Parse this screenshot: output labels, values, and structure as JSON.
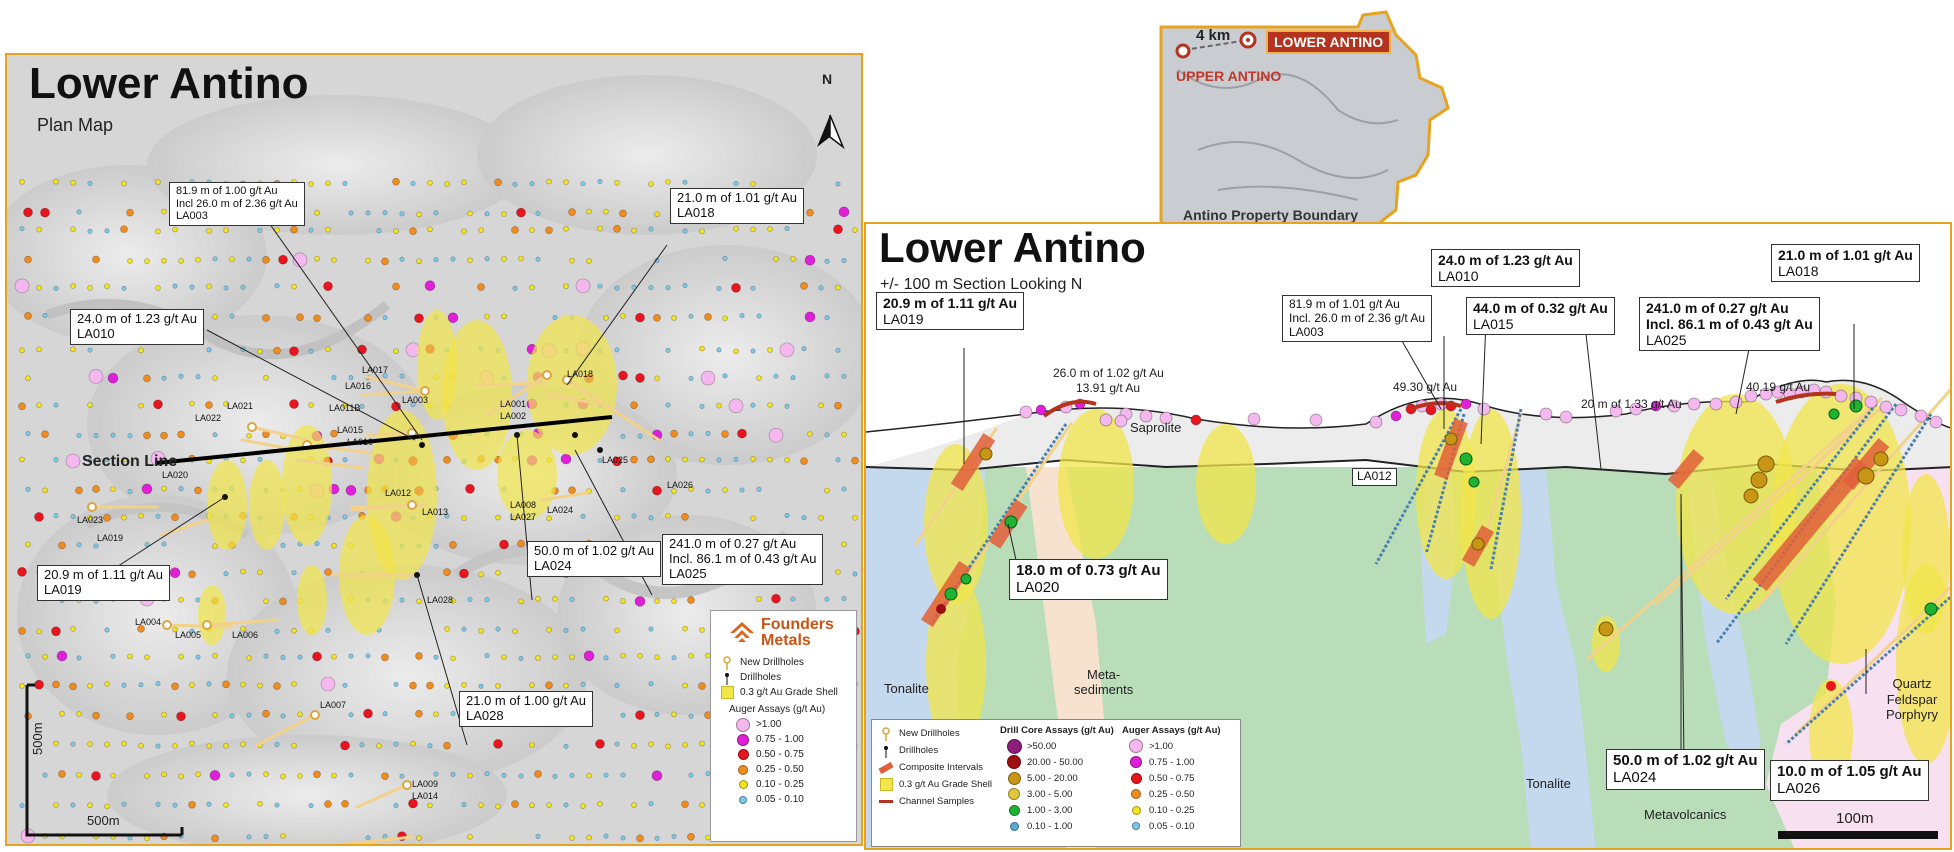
{
  "plan_map": {
    "title": "Lower Antino",
    "subtitle": "Plan Map",
    "north": "N",
    "section_line_label": "Section Line",
    "scale_h": "500m",
    "scale_v": "500m",
    "holes": [
      "LA001",
      "LA002",
      "LA003",
      "LA004",
      "LA005",
      "LA006",
      "LA007",
      "LA008",
      "LA009",
      "LA010",
      "LA011B",
      "LA012",
      "LA013",
      "LA014",
      "LA015",
      "LA016",
      "LA017",
      "LA018",
      "LA019",
      "LA020",
      "LA021",
      "LA022",
      "LA023",
      "LA024",
      "LA025",
      "LA026",
      "LA027",
      "LA028"
    ],
    "callouts": {
      "la003": [
        "81.9 m of 1.00 g/t Au",
        "Incl 26.0 m of 2.36 g/t Au",
        "LA003"
      ],
      "la018": [
        "21.0 m of 1.01 g/t Au",
        "LA018"
      ],
      "la010": [
        "24.0 m of 1.23 g/t Au",
        "LA010"
      ],
      "la019": [
        "20.9 m of 1.11 g/t Au",
        "LA019"
      ],
      "la024": [
        "50.0 m of 1.02 g/t Au",
        "LA024"
      ],
      "la025": [
        "241.0 m of 0.27 g/t Au",
        "Incl. 86.1 m of 0.43 g/t Au",
        "LA025"
      ],
      "la028": [
        "21.0 m of 1.00 g/t Au",
        "LA028"
      ]
    },
    "legend": {
      "brand_line1": "Founders",
      "brand_line2": "Metals",
      "new_drillholes": "New Drillholes",
      "drillholes": "Drillholes",
      "grade_shell": "0.3 g/t Au Grade Shell",
      "auger_title": "Auger Assays (g/t Au)",
      "auger_classes": [
        {
          "label": ">1.00",
          "color": "#f4b8ee"
        },
        {
          "label": "0.75 - 1.00",
          "color": "#e020d8"
        },
        {
          "label": "0.50 - 0.75",
          "color": "#e8141e"
        },
        {
          "label": "0.25 - 0.50",
          "color": "#f08c1e"
        },
        {
          "label": "0.10 - 0.25",
          "color": "#f4e41e"
        },
        {
          "label": "0.05 - 0.10",
          "color": "#7cc8e8"
        }
      ]
    }
  },
  "inset": {
    "distance": "4 km",
    "lower_label": "LOWER ANTINO",
    "upper_label": "UPPER ANTINO",
    "boundary_label": "Antino Property Boundary"
  },
  "section": {
    "title": "Lower Antino",
    "subtitle": "+/- 100 m Section Looking N",
    "units": {
      "saprolite": "Saprolite",
      "metasediments": [
        "Meta-",
        "sediments"
      ],
      "tonalite_left": "Tonalite",
      "tonalite_right": "Tonalite",
      "metavolcanics": "Metavolcanics",
      "qfp": [
        "Quartz",
        "Feldspar",
        "Porphyry"
      ]
    },
    "callouts": {
      "la019": [
        "20.9 m of 1.11 g/t Au",
        "LA019"
      ],
      "la020": [
        "18.0 m of 0.73 g/t Au",
        "LA020"
      ],
      "la003": [
        "81.9 m of 1.01 g/t Au",
        "Incl. 26.0 m of 2.36 g/t Au",
        "LA003"
      ],
      "la010": [
        "24.0 m of 1.23 g/t Au",
        "LA010"
      ],
      "la015": [
        "44.0 m of 0.32 g/t Au",
        "LA015"
      ],
      "la025": [
        "241.0 m of 0.27 g/t Au",
        "Incl. 86.1 m of 0.43 g/t Au",
        "LA025"
      ],
      "la018": [
        "21.0 m of 1.01 g/t Au",
        "LA018"
      ],
      "la024": [
        "50.0 m of 1.02 g/t Au",
        "LA024"
      ],
      "la026": [
        "10.0 m of 1.05 g/t Au",
        "LA026"
      ],
      "la012": "LA012"
    },
    "annotations": {
      "channel_a": "26.0 m of 1.02 g/t Au",
      "channel_b": "13.91 g/t Au",
      "point_a": "49.30 g/t Au",
      "channel_c": "20 m of 1.33 g/t Au",
      "point_b": "40.19 g/t Au"
    },
    "scale": "100m",
    "legend": {
      "new_drillholes": "New Drillholes",
      "drillholes": "Drillholes",
      "composite": "Composite Intervals",
      "grade_shell": "0.3 g/t Au Grade Shell",
      "channel": "Channel Samples",
      "core_title": "Drill Core Assays (g/t Au)",
      "core_classes": [
        {
          "label": ">50.00",
          "color": "#8a1e7a"
        },
        {
          "label": "20.00 - 50.00",
          "color": "#9e0f14"
        },
        {
          "label": "5.00 - 20.00",
          "color": "#c89614"
        },
        {
          "label": "3.00 - 5.00",
          "color": "#e0c83c"
        },
        {
          "label": "1.00 - 3.00",
          "color": "#1eb432"
        },
        {
          "label": "0.10 - 1.00",
          "color": "#5aaad2"
        }
      ],
      "auger_title": "Auger Assays (g/t Au)",
      "auger_classes": [
        {
          "label": ">1.00",
          "color": "#f4b8ee"
        },
        {
          "label": "0.75 - 1.00",
          "color": "#e020d8"
        },
        {
          "label": "0.50 - 0.75",
          "color": "#e8141e"
        },
        {
          "label": "0.25 - 0.50",
          "color": "#f08c1e"
        },
        {
          "label": "0.10 - 0.25",
          "color": "#f4e41e"
        },
        {
          "label": "0.05 - 0.10",
          "color": "#7cc8e8"
        }
      ]
    }
  }
}
